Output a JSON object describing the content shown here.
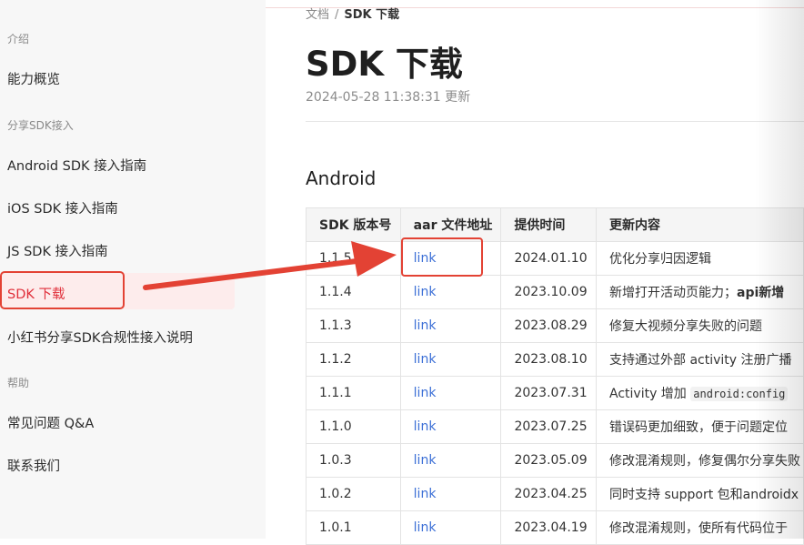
{
  "sidebar": {
    "groups": [
      {
        "title": "介绍",
        "items": [
          "能力概览"
        ]
      },
      {
        "title": "分享SDK接入",
        "items": [
          "Android SDK 接入指南",
          "iOS SDK 接入指南",
          "JS SDK 接入指南",
          "SDK 下载",
          "小红书分享SDK合规性接入说明"
        ]
      },
      {
        "title": "帮助",
        "items": [
          "常见问题 Q&A",
          "联系我们"
        ]
      }
    ],
    "active_item": "SDK 下载"
  },
  "breadcrumb": {
    "parent": "文档",
    "separator": "/",
    "current": "SDK 下载"
  },
  "page": {
    "title": "SDK 下载",
    "updated": "2024-05-28 11:38:31 更新",
    "section": "Android"
  },
  "table": {
    "headers": [
      "SDK 版本号",
      "aar 文件地址",
      "提供时间",
      "更新内容"
    ],
    "rows": [
      {
        "version": "1.1.5",
        "link": "link",
        "date": "2024.01.10",
        "content": "优化分享归因逻辑"
      },
      {
        "version": "1.1.4",
        "link": "link",
        "date": "2023.10.09",
        "content": "新增打开活动页能力；",
        "content_bold": "api新增"
      },
      {
        "version": "1.1.3",
        "link": "link",
        "date": "2023.08.29",
        "content": "修复大视频分享失败的问题"
      },
      {
        "version": "1.1.2",
        "link": "link",
        "date": "2023.08.10",
        "content": "支持通过外部 activity 注册广播"
      },
      {
        "version": "1.1.1",
        "link": "link",
        "date": "2023.07.31",
        "content": "Activity 增加 ",
        "content_code": "android:config"
      },
      {
        "version": "1.1.0",
        "link": "link",
        "date": "2023.07.25",
        "content": "错误码更加细致，便于问题定位"
      },
      {
        "version": "1.0.3",
        "link": "link",
        "date": "2023.05.09",
        "content": "修改混淆规则，修复偶尔分享失败"
      },
      {
        "version": "1.0.2",
        "link": "link",
        "date": "2023.04.25",
        "content": "同时支持 support 包和androidx"
      },
      {
        "version": "1.0.1",
        "link": "link",
        "date": "2023.04.19",
        "content": "修改混淆规则，使所有代码位于"
      }
    ]
  },
  "annotation": {
    "color": "#e34234"
  }
}
